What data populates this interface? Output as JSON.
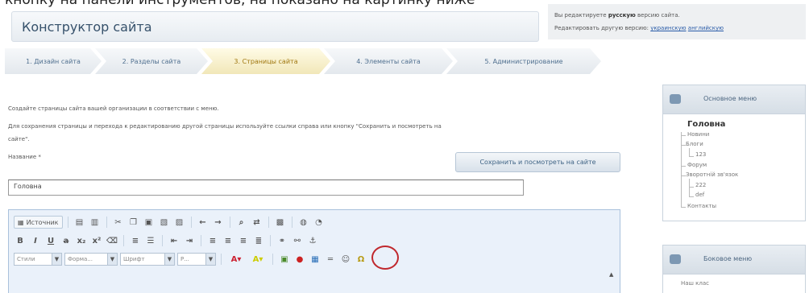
{
  "caption": "кнопку на панели инструментов, на показано на картинку ниже",
  "header": {
    "title": "Конструктор сайта"
  },
  "version_info": {
    "line1_prefix": "Вы редактируете",
    "line1_bold": "русскую",
    "line1_suffix": "версию сайта.",
    "line2_prefix": "Редактировать другую версию:",
    "link_uk": "украинскую",
    "link_en": "английскую"
  },
  "steps": [
    {
      "label": "1. Дизайн сайта",
      "active": false
    },
    {
      "label": "2. Разделы сайта",
      "active": false
    },
    {
      "label": "3. Страницы сайта",
      "active": true
    },
    {
      "label": "4. Элементы сайта",
      "active": false
    },
    {
      "label": "5. Администрирование",
      "active": false
    }
  ],
  "main": {
    "intro_text": "Создайте страницы сайта вашей организации в соответствии с меню.",
    "help_text_1": "Для сохранения страницы и перехода к редактированию другой страницы используйте ссылки справа или кнопку \"Сохранить и посмотреть на",
    "help_text_2": "сайте\".",
    "name_label": "Название *",
    "save_button": "Сохранить и посмотреть на сайте",
    "name_value": "Головна"
  },
  "editor": {
    "source_label": "Источник",
    "style_combo": "Стили",
    "format_combo": "Форма...",
    "font_combo": "Шрифт",
    "size_combo": "Р...",
    "scroll_glyph": "▲"
  },
  "menus": {
    "main_title": "Основное меню",
    "main_items": {
      "root": "Головна",
      "news": "Новини",
      "blogs": "Блоги",
      "blogs_child": "123",
      "forum": "Форум",
      "feedback": "Зворотній зв'язок",
      "feedback_child1": "222",
      "feedback_child2": "def",
      "contacts": "Контакты"
    },
    "side_title": "Боковое меню",
    "side_items": {
      "first": "Наш клас"
    }
  },
  "colors": {
    "highlight": "#c0282d",
    "active_step": "#a0770e",
    "link": "#2a5ca8"
  }
}
